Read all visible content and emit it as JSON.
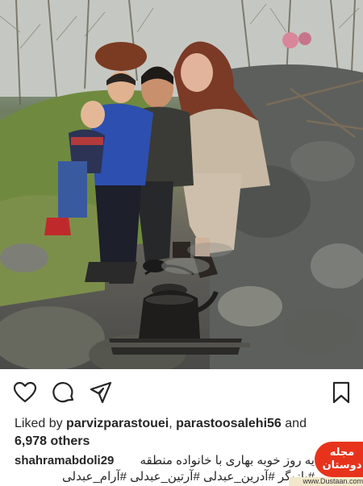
{
  "photo": {
    "alt": "Family photo by the river"
  },
  "actions": {
    "like": "heart-icon",
    "comment": "comment-icon",
    "share": "share-icon",
    "save": "bookmark-icon"
  },
  "likes": {
    "prefix": "Liked by ",
    "user1": "parvizparastouei",
    "separator": ", ",
    "user2": "parastoosalehi56",
    "conjunction": " and",
    "others": "6,978 others"
  },
  "caption": {
    "username": "shahramabdoli29",
    "line1": "یه روز خوبه بهاری با خانواده  منطقه",
    "line2": "#بازیگر #آدرین_عبدلی #آرتین_عبدلی #آرام_عبدلی"
  },
  "watermark": {
    "logo": "مجله دوستان",
    "url": "www.Dustaan.com"
  }
}
